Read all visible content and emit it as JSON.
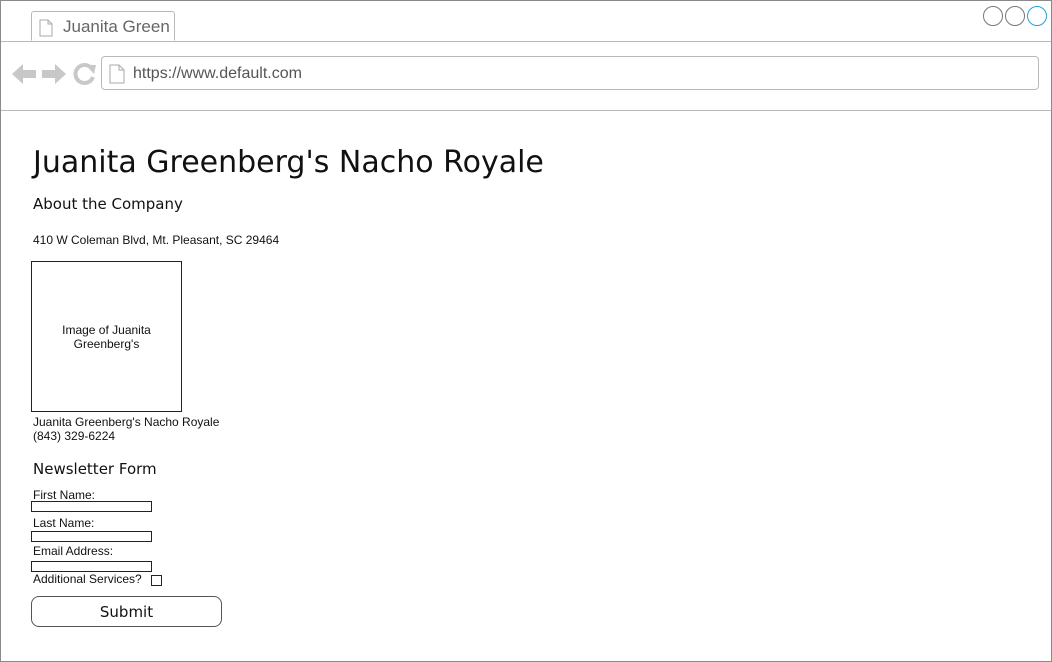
{
  "browser": {
    "tab_title": "Juanita Green",
    "url": "https://www.default.com",
    "icons": {
      "tab": "page-icon",
      "back": "back-arrow-icon",
      "forward": "forward-arrow-icon",
      "reload": "reload-icon",
      "url": "page-icon"
    },
    "colors": {
      "maximize_ring": "#26a0da",
      "nav_icons": "#c8c8c8"
    }
  },
  "page": {
    "title": "Juanita Greenberg's Nacho Royale",
    "about_heading": "About the Company",
    "address": "410 W Coleman Blvd, Mt. Pleasant, SC 29464",
    "image_placeholder": "Image of Juanita Greenberg's",
    "caption_name": "Juanita Greenberg's Nacho Royale",
    "caption_phone": "(843) 329-6224"
  },
  "form": {
    "heading": "Newsletter Form",
    "first_name_label": "First Name:",
    "first_name_value": "",
    "last_name_label": "Last Name:",
    "last_name_value": "",
    "email_label": "Email Address:",
    "email_value": "",
    "additional_services_label": "Additional Services?",
    "additional_services_checked": false,
    "submit_label": "Submit"
  }
}
